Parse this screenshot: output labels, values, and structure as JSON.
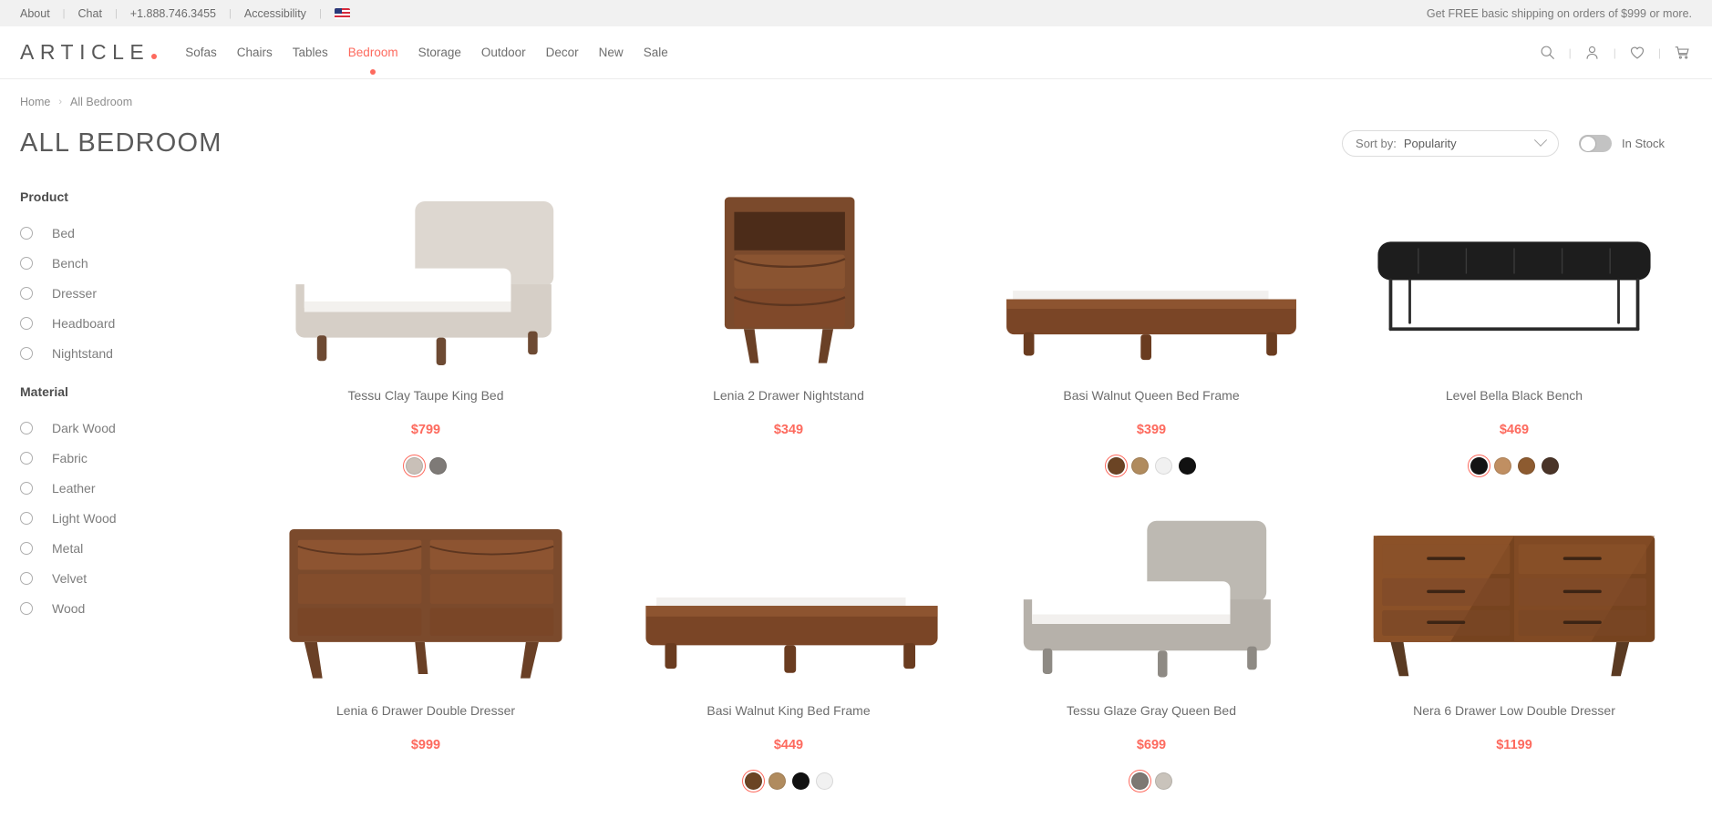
{
  "utility_bar": {
    "links": [
      "About",
      "Chat",
      "+1.888.746.3455",
      "Accessibility"
    ],
    "separator": "|",
    "flag_icon": "us-flag-icon",
    "promo": "Get FREE basic shipping on orders of $999 or more."
  },
  "header": {
    "logo": "ARTICLE",
    "logo_dot_color": "#fd6a5e",
    "nav": [
      {
        "label": "Sofas",
        "active": false
      },
      {
        "label": "Chairs",
        "active": false
      },
      {
        "label": "Tables",
        "active": false
      },
      {
        "label": "Bedroom",
        "active": true
      },
      {
        "label": "Storage",
        "active": false
      },
      {
        "label": "Outdoor",
        "active": false
      },
      {
        "label": "Decor",
        "active": false
      },
      {
        "label": "New",
        "active": false
      },
      {
        "label": "Sale",
        "active": false
      }
    ],
    "icons": [
      "search-icon",
      "account-icon",
      "wishlist-heart-icon",
      "cart-icon"
    ]
  },
  "breadcrumb": {
    "items": [
      "Home",
      "All Bedroom"
    ],
    "separator": "›"
  },
  "page": {
    "title": "ALL BEDROOM",
    "accent_color": "#fd6a5e"
  },
  "controls": {
    "sort_label": "Sort by:",
    "sort_value": "Popularity",
    "sort_options": [
      "Popularity"
    ],
    "in_stock_label": "In Stock",
    "in_stock_on": false
  },
  "filters": [
    {
      "title": "Product",
      "options": [
        "Bed",
        "Bench",
        "Dresser",
        "Headboard",
        "Nightstand"
      ]
    },
    {
      "title": "Material",
      "options": [
        "Dark Wood",
        "Fabric",
        "Leather",
        "Light Wood",
        "Metal",
        "Velvet",
        "Wood"
      ]
    }
  ],
  "products": [
    {
      "name": "Tessu Clay Taupe King Bed",
      "price": "$799",
      "image": "upholstered-platform-bed-taupe",
      "swatches": [
        {
          "color": "#c9c0b8",
          "selected": true
        },
        {
          "color": "#7e7a77",
          "selected": false
        }
      ]
    },
    {
      "name": "Lenia 2 Drawer Nightstand",
      "price": "$349",
      "image": "walnut-2-drawer-nightstand",
      "swatches": []
    },
    {
      "name": "Basi Walnut Queen Bed Frame",
      "price": "$399",
      "image": "walnut-platform-bed-frame",
      "swatches": [
        {
          "color": "#6b4424",
          "selected": true
        },
        {
          "color": "#b08b5e",
          "selected": false
        },
        {
          "color": "#f1f1f1",
          "selected": false
        },
        {
          "color": "#111111",
          "selected": false
        }
      ]
    },
    {
      "name": "Level Bella Black Bench",
      "price": "$469",
      "image": "black-leather-tufted-bench",
      "swatches": [
        {
          "color": "#141414",
          "selected": true
        },
        {
          "color": "#c08f62",
          "selected": false
        },
        {
          "color": "#8d5b30",
          "selected": false
        },
        {
          "color": "#4a3428",
          "selected": false
        }
      ]
    },
    {
      "name": "Lenia 6 Drawer Double Dresser",
      "price": "$999",
      "image": "walnut-6-drawer-dresser",
      "swatches": []
    },
    {
      "name": "Basi Walnut King Bed Frame",
      "price": "$449",
      "image": "walnut-king-platform-bed",
      "swatches": [
        {
          "color": "#6b4424",
          "selected": true
        },
        {
          "color": "#b08b5e",
          "selected": false
        },
        {
          "color": "#111111",
          "selected": false
        },
        {
          "color": "#f1f1f1",
          "selected": false
        }
      ]
    },
    {
      "name": "Tessu Glaze Gray Queen Bed",
      "price": "$699",
      "image": "upholstered-gray-queen-bed",
      "swatches": [
        {
          "color": "#7e7873",
          "selected": true
        },
        {
          "color": "#c9c3bb",
          "selected": false
        }
      ]
    },
    {
      "name": "Nera 6 Drawer Low Double Dresser",
      "price": "$1199",
      "image": "chevron-walnut-low-dresser",
      "swatches": []
    }
  ]
}
